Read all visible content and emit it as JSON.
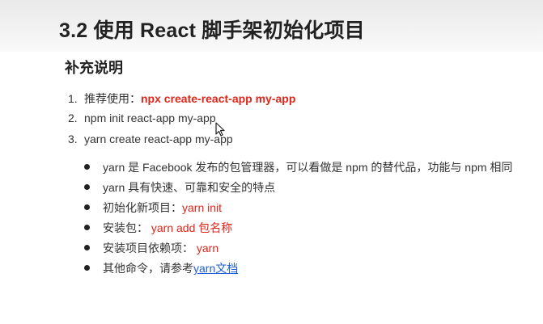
{
  "slide": {
    "title": "3.2 使用 React 脚手架初始化项目",
    "section_heading": "补充说明"
  },
  "numbered_list": [
    {
      "num": "1.",
      "text": "推荐使用：",
      "highlight": "npx create-react-app  my-app"
    },
    {
      "num": "2.",
      "text": "npm init react-app my-app"
    },
    {
      "num": "3.",
      "text": "yarn create react-app my-app"
    }
  ],
  "bullets": [
    {
      "text": "yarn 是 Facebook 发布的包管理器，可以看做是 npm 的替代品，功能与 npm 相同"
    },
    {
      "text": "yarn 具有快速、可靠和安全的特点"
    },
    {
      "text": "初始化新项目：",
      "highlight": "yarn init"
    },
    {
      "text": "安装包： ",
      "highlight": "yarn add 包名称"
    },
    {
      "text": "安装项目依赖项： ",
      "highlight": "yarn"
    },
    {
      "text": "其他命令，请参考",
      "link": "yarn文档"
    }
  ],
  "colors": {
    "highlight": "#e1251b",
    "link": "#1f5fd8"
  },
  "icons": {
    "cursor": "mouse-pointer-icon"
  }
}
